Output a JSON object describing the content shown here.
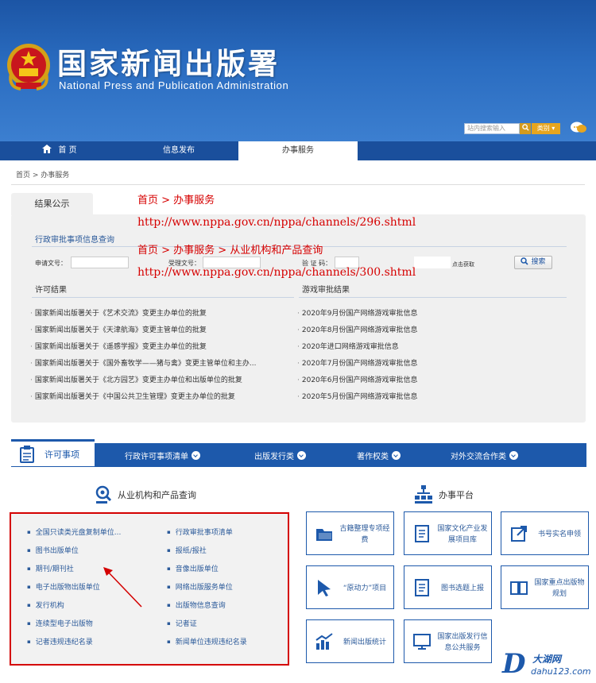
{
  "header": {
    "title": "国家新闻出版署",
    "subtitle": "National Press and Publication Administration",
    "search_placeholder": "站内搜索输入",
    "category_label": "类别 ▾"
  },
  "nav": {
    "home": "首 页",
    "info": "信息发布",
    "service": "办事服务"
  },
  "breadcrumb": "首页 > 办事服务",
  "result": {
    "tab_label": "结果公示",
    "approval_search_title": "行政审批事项信息查询",
    "form": {
      "apply_no_label": "申请文号：",
      "accept_no_label": "受理文号：",
      "verify_label": "验 证 码：",
      "refresh_label": "点击获取",
      "search_button": "搜索"
    },
    "license_title": "许可结果",
    "license_items": [
      "国家新闻出版署关于《艺术交流》变更主办单位的批复",
      "国家新闻出版署关于《天津航海》变更主管单位的批复",
      "国家新闻出版署关于《遥感学报》变更主办单位的批复",
      "国家新闻出版署关于《国外畜牧学——猪与禽》变更主管单位和主办...",
      "国家新闻出版署关于《北方园艺》变更主办单位和出版单位的批复",
      "国家新闻出版署关于《中国公共卫生管理》变更主办单位的批复"
    ],
    "game_title": "游戏审批结果",
    "game_items": [
      "2020年9月份国产网络游戏审批信息",
      "2020年8月份国产网络游戏审批信息",
      "2020年进口网络游戏审批信息",
      "2020年7月份国产网络游戏审批信息",
      "2020年6月份国产网络游戏审批信息",
      "2020年5月份国产网络游戏审批信息"
    ]
  },
  "annotations": [
    "首页 > 办事服务",
    "http://www.nppa.gov.cn/nppa/channels/296.shtml",
    "首页 > 办事服务 > 从业机构和产品查询",
    "http://www.nppa.gov.cn/nppa/channels/300.shtml"
  ],
  "categories": {
    "active": "许可事项",
    "items": [
      "行政许可事项清单",
      "出版发行类",
      "著作权类",
      "对外交流合作类"
    ]
  },
  "query": {
    "title": "从业机构和产品查询",
    "left_items": [
      "全国只读类光盘复制单位...",
      "图书出版单位",
      "期刊/期刊社",
      "电子出版物出版单位",
      "发行机构",
      "连续型电子出版物",
      "记者违规违纪名录"
    ],
    "right_items": [
      "行政审批事项清单",
      "报纸/报社",
      "音像出版单位",
      "网络出版服务单位",
      "出版物信息查询",
      "记者证",
      "新闻单位违规违纪名录"
    ]
  },
  "platform": {
    "title": "办事平台",
    "cards": [
      {
        "label": "古籍整理专项经费",
        "icon": "folder-icon"
      },
      {
        "label": "国家文化产业发展项目库",
        "icon": "document-icon"
      },
      {
        "label": "书号实名申领",
        "icon": "external-link-icon"
      },
      {
        "label": "“原动力”项目",
        "icon": "cursor-icon"
      },
      {
        "label": "图书选题上报",
        "icon": "document-icon"
      },
      {
        "label": "国家重点出版物规划",
        "icon": "book-icon"
      },
      {
        "label": "新闻出版统计",
        "icon": "chart-icon"
      },
      {
        "label": "国家出版发行信息公共服务",
        "icon": "monitor-icon"
      }
    ]
  },
  "watermark": {
    "cn": "大湖网",
    "url": "dahu123.com"
  },
  "colors": {
    "brand": "#1d59ab",
    "annotation": "#d60000"
  }
}
